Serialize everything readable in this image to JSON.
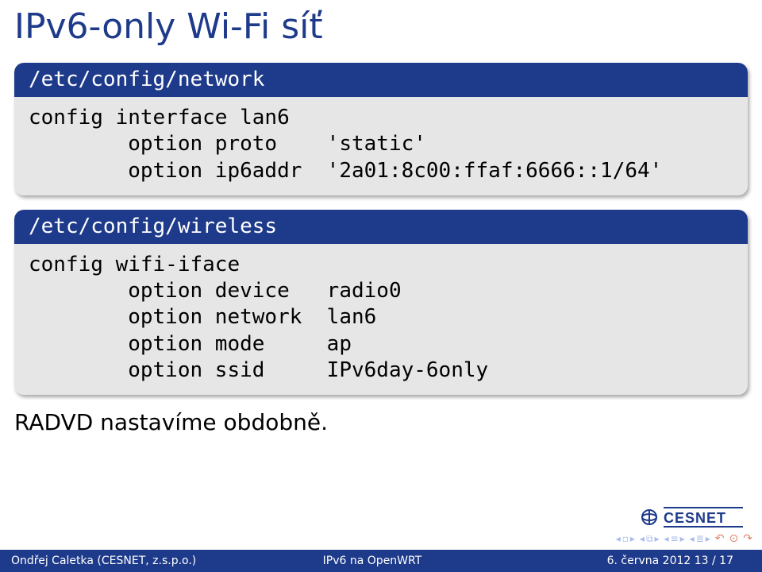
{
  "title": "IPv6-only Wi-Fi síť",
  "block1": {
    "header": "/etc/config/network",
    "lines": [
      "config interface lan6",
      "        option proto    'static'",
      "        option ip6addr  '2a01:8c00:ffaf:6666::1/64'"
    ]
  },
  "block2": {
    "header": "/etc/config/wireless",
    "lines": [
      "config wifi-iface",
      "        option device   radio0",
      "        option network  lan6",
      "        option mode     ap",
      "        option ssid     IPv6day-6only"
    ]
  },
  "after_text": "RADVD nastavíme obdobně.",
  "logo_text": "CESNET",
  "footer": {
    "left": "Ondřej Caletka (CESNET, z.s.p.o.)",
    "center": "IPv6 na OpenWRT",
    "right": "6. června 2012      13 / 17"
  }
}
